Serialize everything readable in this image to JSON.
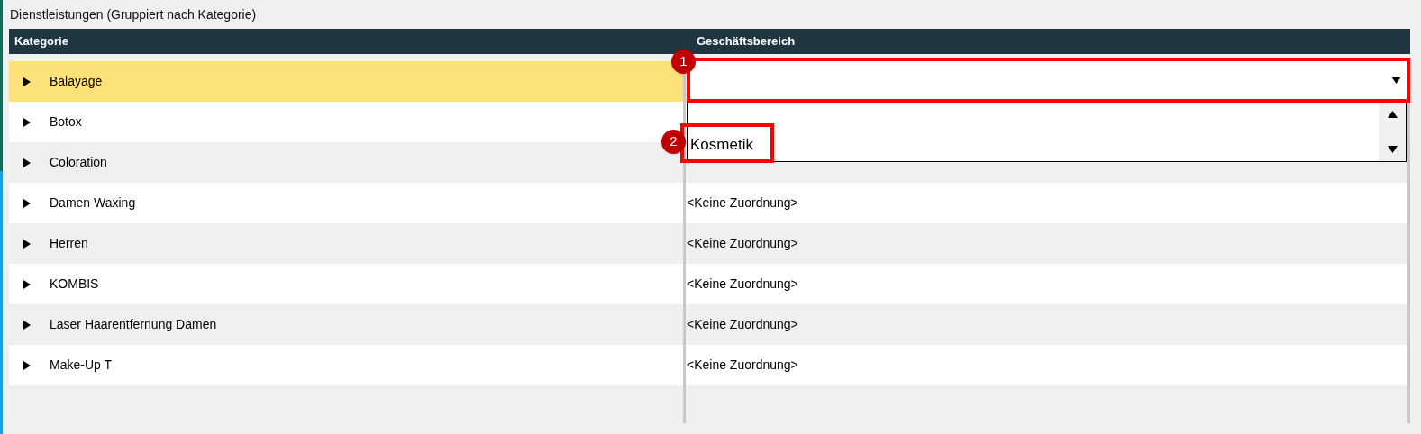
{
  "title": "Dienstleistungen (Gruppiert nach Kategorie)",
  "columns": [
    "Kategorie",
    "Geschäftsbereich"
  ],
  "rows": [
    {
      "category": "Balayage",
      "expanded": false,
      "selected": true
    },
    {
      "category": "Botox",
      "expanded": false,
      "selected": false
    },
    {
      "category": "Coloration",
      "expanded": false,
      "selected": false
    },
    {
      "category": "Damen Waxing",
      "assignment": "<Keine Zuordnung>",
      "expanded": false,
      "selected": false
    },
    {
      "category": "Herren",
      "assignment": "<Keine Zuordnung>",
      "expanded": false,
      "selected": false
    },
    {
      "category": "KOMBIS",
      "assignment": "<Keine Zuordnung>",
      "expanded": false,
      "selected": false
    },
    {
      "category": "Laser Haarentfernung Damen",
      "assignment": "<Keine Zuordnung>",
      "expanded": false,
      "selected": false
    },
    {
      "category": "Make-Up T",
      "assignment": "<Keine Zuordnung>",
      "expanded": false,
      "selected": false
    }
  ],
  "dropdown": {
    "open": true,
    "options": [
      {
        "label": "Kosmetik",
        "selected": false
      }
    ]
  },
  "annotations": [
    {
      "number": "1"
    },
    {
      "number": "2"
    }
  ]
}
